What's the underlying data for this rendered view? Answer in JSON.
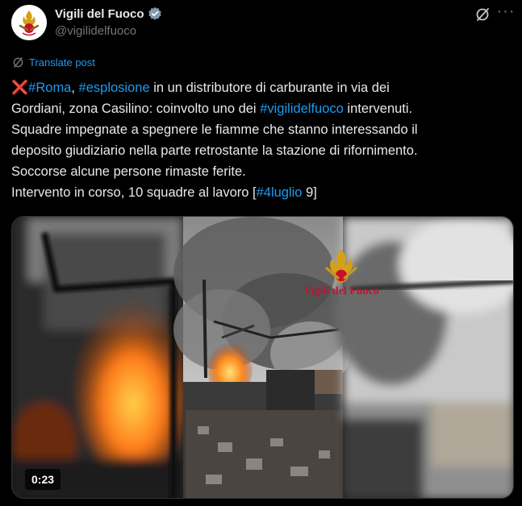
{
  "author": {
    "display_name": "Vigili del Fuoco",
    "handle": "@vigilidelfuoco",
    "avatar_icon": "vvf-emblem-icon",
    "verified_icon": "verified-badge-icon"
  },
  "actions": {
    "grok_icon": "grok-icon",
    "more_icon": "more-icon",
    "more_label": "···"
  },
  "translate": {
    "label": "Translate post",
    "icon": "translate-icon"
  },
  "tweet": {
    "cross": "❌",
    "tag_roma": "#Roma",
    "sep1": ", ",
    "tag_esplosione": "#esplosione",
    "line1_rest": " in un distributore di carburante in via dei",
    "line2_pre": "Gordiani, zona Casilino: coinvolto uno dei ",
    "tag_vvf": "#vigilidelfuoco",
    "line2_post": " intervenuti.",
    "line3": "Squadre impegnate a spegnere le fiamme che stanno interessando il",
    "line4": "deposito giudiziario nella parte retrostante la stazione di rifornimento.",
    "line5": "Soccorse alcune persone rimaste ferite.",
    "line6_pre": "Intervento in corso, 10 squadre al lavoro [",
    "tag_date": "#4luglio",
    "line6_post": " 9]"
  },
  "media": {
    "type": "video",
    "duration": "0:23",
    "watermark": "Vigili del Fuoco",
    "colors": {
      "flame": "#ff7a1a",
      "smoke": "#6e6e6e",
      "sky": "#d9d9d9"
    }
  },
  "colors": {
    "background": "#000000",
    "text": "#e7e9ea",
    "muted": "#71767b",
    "link": "#1d9bf0",
    "verified": "#829aab"
  }
}
